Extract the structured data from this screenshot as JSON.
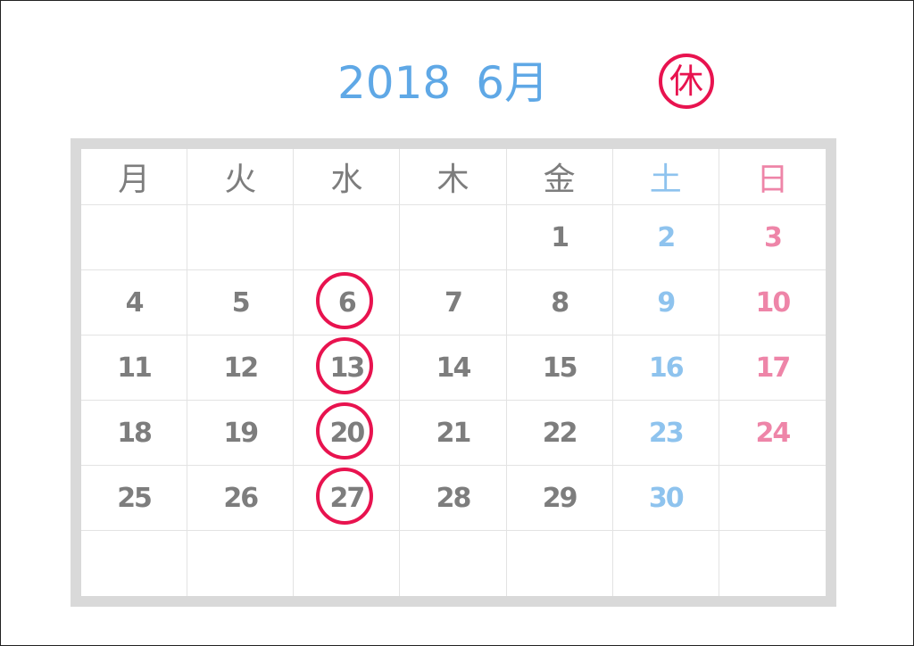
{
  "calendar": {
    "year": "2018",
    "month": "6月",
    "holiday_label": "休",
    "weekdays": [
      "月",
      "火",
      "水",
      "木",
      "金",
      "土",
      "日"
    ],
    "weeks": [
      [
        null,
        null,
        null,
        null,
        1,
        2,
        3
      ],
      [
        4,
        5,
        6,
        7,
        8,
        9,
        10
      ],
      [
        11,
        12,
        13,
        14,
        15,
        16,
        17
      ],
      [
        18,
        19,
        20,
        21,
        22,
        23,
        24
      ],
      [
        25,
        26,
        27,
        28,
        29,
        30,
        null
      ],
      [
        null,
        null,
        null,
        null,
        null,
        null,
        null
      ]
    ],
    "circled_days": [
      6,
      13,
      20,
      27
    ]
  },
  "colors": {
    "title": "#5fa8e6",
    "weekday_text": "#7d7d7d",
    "day_text": "#7d7d7d",
    "saturday": "#8ec3ee",
    "sunday": "#ee85a8",
    "holiday_circle": "#e8134f",
    "frame_border": "#d9d9d9",
    "grid_line": "#e3e3e3"
  }
}
